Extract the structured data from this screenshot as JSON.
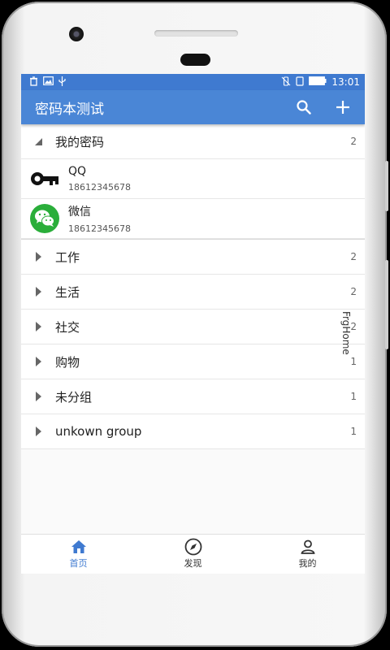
{
  "statusbar": {
    "time": "13:01"
  },
  "appbar": {
    "title": "密码本测试"
  },
  "groups_top": {
    "label": "我的密码",
    "count": "2"
  },
  "entries": [
    {
      "name": "QQ",
      "phone": "18612345678",
      "icon": "key-icon"
    },
    {
      "name": "微信",
      "phone": "18612345678",
      "icon": "wechat-icon"
    }
  ],
  "groups": [
    {
      "label": "工作",
      "count": "2"
    },
    {
      "label": "生活",
      "count": "2"
    },
    {
      "label": "社交",
      "count": "2"
    },
    {
      "label": "购物",
      "count": "1"
    },
    {
      "label": "未分组",
      "count": "1"
    },
    {
      "label": "unkown group",
      "count": "1"
    }
  ],
  "vertical_label": "FrgHome",
  "bottomnav": [
    {
      "label": "首页",
      "icon": "home-icon"
    },
    {
      "label": "发现",
      "icon": "compass-icon"
    },
    {
      "label": "我的",
      "icon": "user-icon"
    }
  ],
  "colors": {
    "primary": "#4a86d6",
    "statusbar": "#3f7ad0",
    "wechat": "#2aae3a"
  }
}
